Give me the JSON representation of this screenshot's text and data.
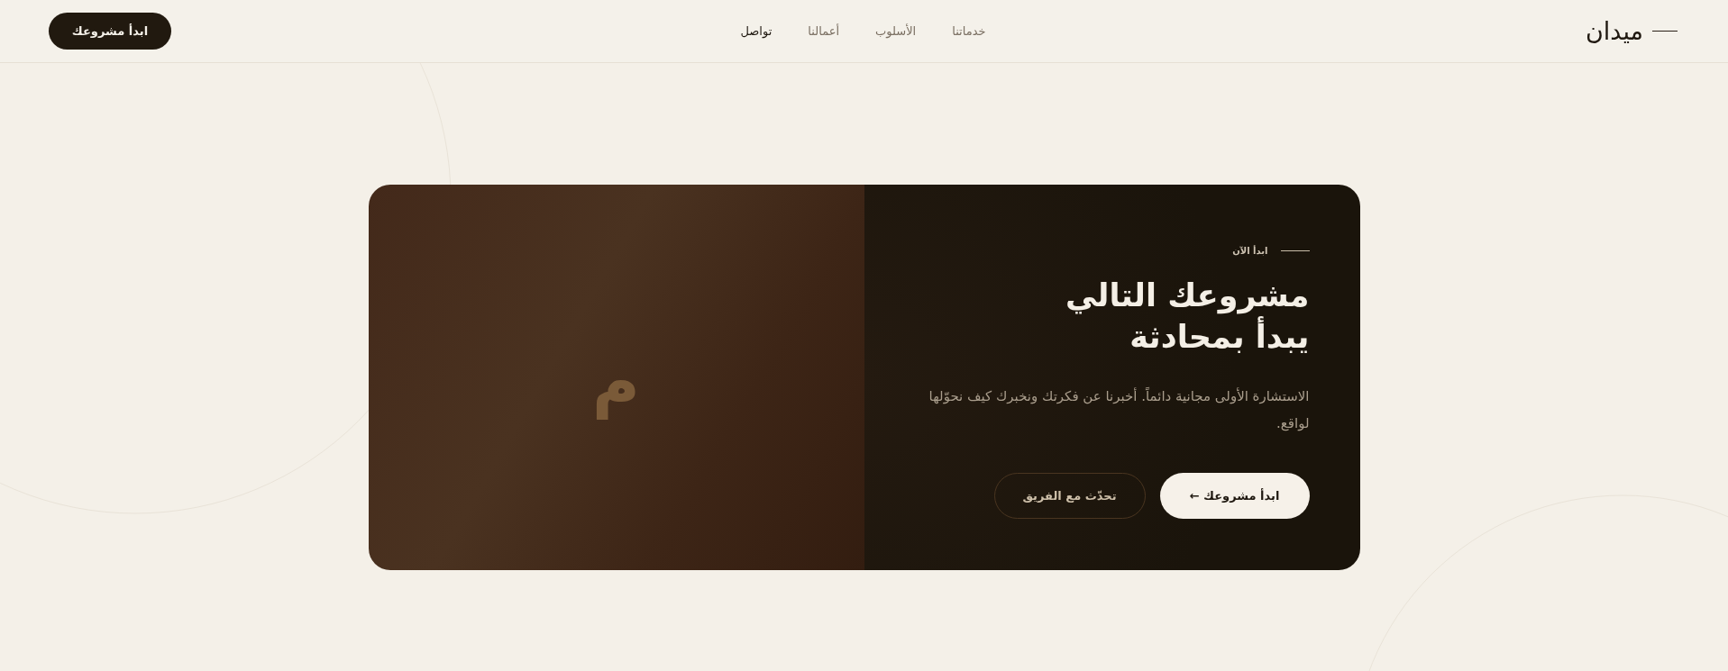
{
  "header": {
    "logo": "ميدان",
    "nav": [
      {
        "label": "خدماتنا",
        "selected": false
      },
      {
        "label": "الأسلوب",
        "selected": false
      },
      {
        "label": "أعمالنا",
        "selected": false
      },
      {
        "label": "تواصل",
        "selected": true
      }
    ],
    "cta": "ابدأ مشروعك"
  },
  "cta_card": {
    "eyebrow": "ابدأ الآن",
    "title_lines": [
      "مشروعك التالي",
      "يبدأ بمحادثة"
    ],
    "description": "الاستشارة الأولى مجانية دائماً. أخبرنا عن فكرتك ونخبرك كيف نحوّلها لواقع.",
    "buttons": [
      {
        "label": "ابدأ مشروعك ←",
        "kind": "primary"
      },
      {
        "label": "تحدّث مع الفريق",
        "kind": "outline"
      }
    ],
    "mark_letter": "م"
  }
}
